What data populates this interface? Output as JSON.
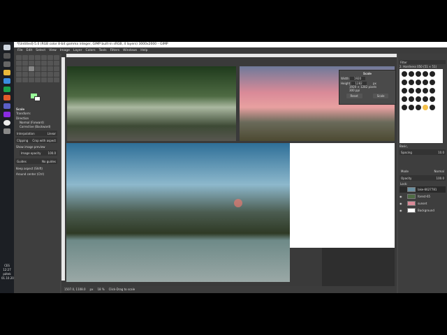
{
  "window": {
    "title": "*[Untitled]-5.0 (RGB color 8-bit gamma integer, GIMP built-in sRGB, 4 layers) 3000x2000 – GIMP"
  },
  "menu": [
    "File",
    "Edit",
    "Select",
    "View",
    "Image",
    "Layer",
    "Colors",
    "Tools",
    "Filters",
    "Windows",
    "Help"
  ],
  "tool_options": {
    "title": "Scale",
    "transform": "Transform:",
    "direction": "Direction",
    "normal": "Normal (Forward)",
    "corrective": "Corrective (Backward)",
    "interpolation_label": "Interpolation",
    "interpolation_value": "Linear",
    "clipping_label": "Clipping",
    "clipping_value": "Crop with aspect",
    "show_preview": "Show image preview",
    "opacity_label": "Image opacity",
    "opacity_value": "100.0",
    "guides_label": "Guides",
    "guides_value": "No guides",
    "keep_aspect": "Keep aspect (Shift)",
    "around_center": "Around center (Ctrl)"
  },
  "scale_dialog": {
    "title": "Scale",
    "width_label": "Width",
    "width_value": "1920",
    "height_label": "Height",
    "height_value": "1282",
    "unit": "px",
    "info": "1920 × 1282 pixels",
    "res": "300 ppi",
    "reset": "Reset",
    "scale": "Scale"
  },
  "status": {
    "coords": "1507.0, 1108.0",
    "unit": "px",
    "zoom": "18 %",
    "message": "Click-Drag to scale"
  },
  "brushes": {
    "filter": "Filter",
    "selected": "2. Hardness 050 (51 × 51)",
    "tag": "Basic,",
    "spacing_label": "Spacing",
    "spacing_value": "10.0"
  },
  "layers": {
    "mode_label": "Mode",
    "mode_value": "Normal",
    "opacity_label": "Opacity",
    "opacity_value": "100.0",
    "lock_label": "Lock:",
    "items": [
      "lake-6627781",
      "forest-65",
      "sunset",
      "Background"
    ]
  },
  "taskbar": {
    "lang": "CES",
    "time": "12:27",
    "day": "pátek",
    "date": "01.10.2021"
  }
}
